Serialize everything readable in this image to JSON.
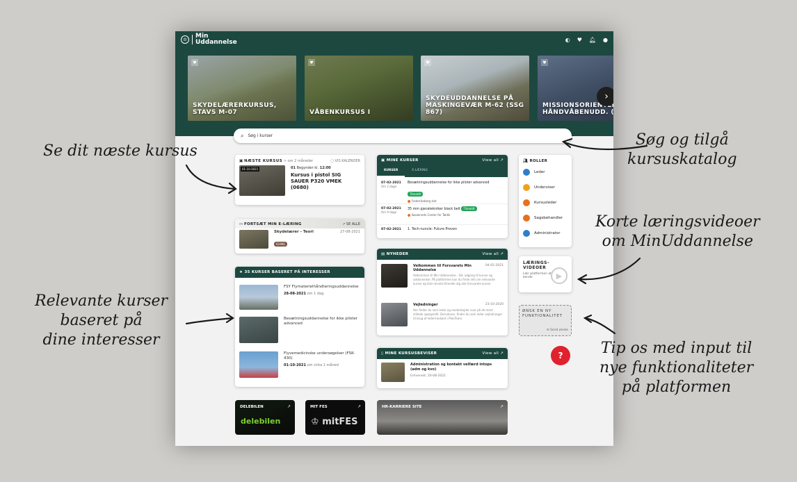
{
  "app": {
    "brand": "Min Uddannelse",
    "brand_line1": "Min",
    "brand_line2": "Uddannelse"
  },
  "topbar_icons": [
    "contrast-icon",
    "heart-icon",
    "bell-icon",
    "user-icon"
  ],
  "hero_cards": [
    {
      "title_l1": "SKYDELÆRERKURSUS,",
      "title_l2": "STAVS M-07"
    },
    {
      "title_l1": "VÅBENKURSUS I",
      "title_l2": ""
    },
    {
      "title_l1": "SKYDEUDDANNELSE PÅ",
      "title_l2": "MASKINGEVÆR M-62 (SSG 867)"
    },
    {
      "title_l1": "MISSIONSORIENTERE",
      "title_l2": "HÅNDVÅBENUDD. (SS"
    }
  ],
  "search": {
    "placeholder": "Søg i kurser"
  },
  "next_course": {
    "heading": "NÆSTE KURSUS",
    "when": "om 2 måneder",
    "calendar": "VIS KALENDER",
    "date_badge": "01-10-2021",
    "starts": "Begynder kl.",
    "day": "01",
    "time": "12:00",
    "title": "Kursus i pistol SIG SAUER P320 VMEK (0680)"
  },
  "elearning": {
    "heading": "FORTSÆT MIN E-LÆRING",
    "see_all": "SE ALLE",
    "item_title": "Skydelærer - Teori",
    "item_date": "27-08-2021",
    "item_badge": "IGANG"
  },
  "interests": {
    "heading": "35 KURSER BASERET PÅ INTERESSER",
    "items": [
      {
        "title": "FSY Flymaterielhåndteringsuddannelse",
        "date": "28-08-2021",
        "meta": "om 1 dag"
      },
      {
        "title": "Besætningsuddannelse for ikke piloter advanced",
        "date": "",
        "meta": ""
      },
      {
        "title": "Flyvemedicinske undersøgelser (FSK-430)",
        "date": "01-10-2021",
        "meta": "om cirka 1 måned"
      }
    ]
  },
  "my_courses": {
    "heading": "MINE KURSER",
    "view_all": "View all",
    "tab1": "KURSER",
    "tab2": "E-LÆRING",
    "items": [
      {
        "date": "07-02-2021",
        "rel": "Om 2 dage",
        "title": "Besætningsuddannelse for ikke piloter advanced",
        "badge": "Tilmeldt",
        "loc": "Frederiksberg slot"
      },
      {
        "date": "07-02-2021",
        "rel": "Om 9 dage",
        "title": "35 mm pjecetekniker black belt",
        "badge": "Tilmeldt",
        "loc": "Søværnets Center for Taktik"
      },
      {
        "date": "07-02-2021",
        "rel": "",
        "title": "1. Tech-nuncle: Future Proven",
        "badge": "",
        "loc": ""
      }
    ]
  },
  "news": {
    "heading": "NYHEDER",
    "view_all": "View all",
    "items": [
      {
        "title": "Velkommen til Forsvarets Min Uddannelse",
        "date": "04-02-2021",
        "body": "Velkommen til Min Uddannelse - Din adgang til kurser og uddannelser. På platformen kan du finde info om relevante kurser og ikke mindst tilmelde dig alle forsvarets kurser."
      },
      {
        "title": "Vejledninger",
        "date": "23-10-2020",
        "body": "Her finder du som leder og medarbejder svar på de mest stillede spørgsmål. Derudover, finder du som leder vejledninger til brug af ledermodulet i PlanTeam."
      }
    ]
  },
  "certificates": {
    "heading": "MINE KURSUSBEVISER",
    "view_all": "View all",
    "title": "Administration og kontakt velfærd intops (adm og kvo)",
    "earned": "Erhvervet: 20-08-2021"
  },
  "roles": {
    "heading": "ROLLER",
    "items": [
      {
        "label": "Leder",
        "color": "#2f7fc8"
      },
      {
        "label": "Underviser",
        "color": "#f0a020"
      },
      {
        "label": "Kursusleder",
        "color": "#e8701e"
      },
      {
        "label": "Sagsbehandler",
        "color": "#e8701e"
      },
      {
        "label": "Administrator",
        "color": "#2f7fc8"
      }
    ]
  },
  "videos": {
    "heading_l1": "LÆRINGS-",
    "heading_l2": "VIDEOER",
    "sub": "Lær platformen at kende"
  },
  "wish": {
    "heading_l1": "ØNSK EN NY",
    "heading_l2": "FUNKTIONALITET",
    "action": "Send ønske"
  },
  "help": {
    "label": "?"
  },
  "links": [
    {
      "label": "DELEBILEN",
      "logo_text": "delebilen"
    },
    {
      "label": "MIT FES",
      "logo_text": "mitFES"
    },
    {
      "label": "HR-KARRIERE SITE"
    }
  ],
  "annotations": {
    "a1": "Se dit næste kursus",
    "a2_l1": "Søg og tilgå",
    "a2_l2": "kursuskatalog",
    "a3_l1": "Korte læringsvideoer",
    "a3_l2": "om MinUddannelse",
    "a4_l1": "Relevante kurser",
    "a4_l2": "baseret på",
    "a4_l3": "dine interesser",
    "a5_l1": "Tip os med input til",
    "a5_l2": "nye funktionaliteter",
    "a5_l3": "på platformen"
  }
}
